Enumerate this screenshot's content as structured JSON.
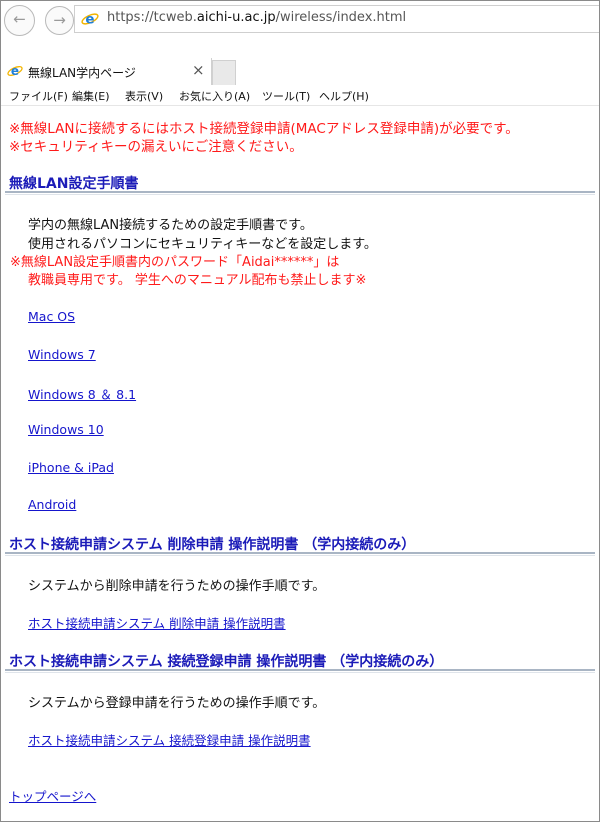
{
  "browser": {
    "url_prefix": "https://tcweb.",
    "url_domain": "aichi-u.ac.jp",
    "url_path": "/wireless/index.html",
    "tab_title": "無線LAN学内ページ",
    "tab_close": "×",
    "back_glyph": "←",
    "forward_glyph": "→",
    "menu": [
      "ファイル(F)",
      "編集(E)",
      "表示(V)",
      "お気に入り(A)",
      "ツール(T)",
      "ヘルプ(H)"
    ]
  },
  "page": {
    "warning_1": "※無線LANに接続するにはホスト接続登録申請(MACアドレス登録申請)が必要です。",
    "warning_2": "※セキュリティキーの漏えいにご注意ください。",
    "section1": {
      "title": "無線LAN設定手順書",
      "desc_1": "学内の無線LAN接続するための設定手順書です。",
      "desc_2": "使用されるパソコンにセキュリティキーなどを設定します。",
      "note_1": "※無線LAN設定手順書内のパスワード「Aidai******」は",
      "note_2": "教職員専用です。 学生へのマニュアル配布も禁止します※",
      "links": [
        "Mac OS",
        "Windows 7",
        "Windows 8 ＆ 8.1",
        "Windows 10",
        "iPhone & iPad",
        "Android"
      ]
    },
    "section2": {
      "title": "ホスト接続申請システム 削除申請  操作説明書 （学内接続のみ）",
      "desc": "システムから削除申請を行うための操作手順です。",
      "link": "ホスト接続申請システム 削除申請  操作説明書"
    },
    "section3": {
      "title": "ホスト接続申請システム 接続登録申請  操作説明書 （学内接続のみ）",
      "desc": "システムから登録申請を行うための操作手順です。",
      "link": "ホスト接続申請システム 接続登録申請  操作説明書"
    },
    "top_link": "トップページへ"
  },
  "colors": {
    "warning": "#ff1a1a",
    "heading": "#1b1bb8",
    "link": "#1515cc"
  },
  "icons": [
    "back-arrow-icon",
    "forward-arrow-icon",
    "ie-logo-icon",
    "close-icon"
  ]
}
